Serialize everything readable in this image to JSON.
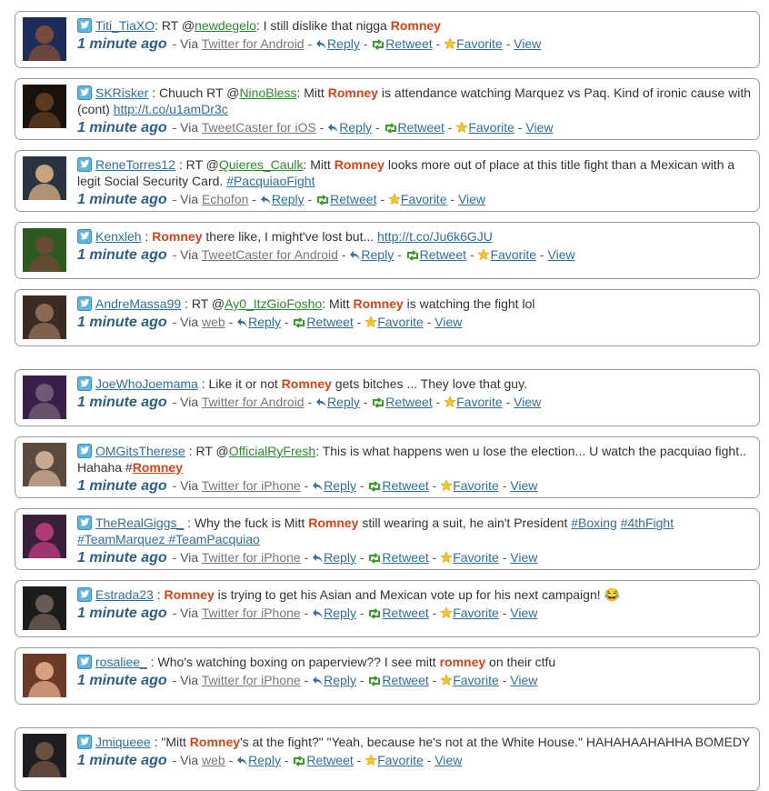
{
  "colors": {
    "highlight": "#d84315",
    "link": "#2f6f9f",
    "mention": "#2b8a2b",
    "time": "#2e5f86"
  },
  "labels": {
    "via": "Via",
    "reply": "Reply",
    "retweet": "Retweet",
    "favorite": "Favorite",
    "view": "View",
    "sep": "-"
  },
  "tweets": [
    {
      "user": "Titi_TiaXO",
      "pre": ": RT @",
      "mention": "newdegelo",
      "mid": ": I still dislike that nigga ",
      "hl": "Romney",
      "post": "",
      "link": "",
      "link2": "",
      "tail": "",
      "time": "1 minute ago",
      "source": "Twitter for Android"
    },
    {
      "user": "SKRisker",
      "pre": " : Chuuch RT @",
      "mention": "NinoBless",
      "mid": ": Mitt ",
      "hl": "Romney",
      "post": " is attendance watching Marquez vs Paq. Kind of ironic cause with (cont) ",
      "link": "http://t.co/u1amDr3c",
      "link2": "",
      "tail": "",
      "time": "1 minute ago",
      "source": "TweetCaster for iOS"
    },
    {
      "user": "ReneTorres12",
      "pre": " : RT @",
      "mention": "Quieres_Caulk",
      "mid": ": Mitt ",
      "hl": "Romney",
      "post": " looks more out of place at this title fight than a Mexican with a legit Social Security Card. ",
      "link": "#PacquiaoFight",
      "link2": "",
      "tail": "",
      "time": "1 minute ago",
      "source": "Echofon"
    },
    {
      "user": "Kenxleh",
      "pre": " : ",
      "mention": "",
      "mid": "",
      "hl": "Romney",
      "post": " there like, I might've lost but... ",
      "link": "http://t.co/Ju6k6GJU",
      "link2": "",
      "tail": "",
      "time": "1 minute ago",
      "source": "TweetCaster for Android"
    },
    {
      "user": "AndreMassa99",
      "pre": " : RT @",
      "mention": "Ay0_ItzGioFosho",
      "mid": ": Mitt ",
      "hl": "Romney",
      "post": " is watching the fight lol",
      "link": "",
      "link2": "",
      "tail": "",
      "time": "1 minute ago",
      "source": "web"
    },
    {
      "user": "JoeWhoJoemama",
      "pre": " : Like it or not ",
      "mention": "",
      "mid": "",
      "hl": "Romney",
      "post": " gets bitches ... They love that guy.",
      "link": "",
      "link2": "",
      "tail": "",
      "time": "1 minute ago",
      "source": "Twitter for Android"
    },
    {
      "user": "OMGitsTherese",
      "pre": " : RT @",
      "mention": "OfficialRyFresh",
      "mid": ": This is what happens wen u lose the election... U watch the pacquiao fight.. Hahaha #",
      "hl": "Romney",
      "post": "",
      "link": "",
      "link2": "",
      "tail": "",
      "time": "1 minute ago",
      "source": "Twitter for iPhone"
    },
    {
      "user": "TheRealGiggs_",
      "pre": " : Why the fuck is Mitt ",
      "mention": "",
      "mid": "",
      "hl": "Romney",
      "post": " still wearing a suit, he ain't President ",
      "link": "#Boxing",
      "link2": "#4thFight",
      "tail": "#TeamMarquez #TeamPacquiao",
      "time": "1 minute ago",
      "source": "Twitter for iPhone"
    },
    {
      "user": "Estrada23",
      "pre": " : ",
      "mention": "",
      "mid": "",
      "hl": "Romney",
      "post": " is trying to get his Asian and Mexican vote up for his next campaign! 😂",
      "link": "",
      "link2": "",
      "tail": "",
      "time": "1 minute ago",
      "source": "Twitter for iPhone"
    },
    {
      "user": "rosaliee_",
      "pre": " : Who's watching boxing on paperview?? I see mitt ",
      "mention": "",
      "mid": "",
      "hl": "romney",
      "post": " on their ctfu",
      "link": "",
      "link2": "",
      "tail": "",
      "time": "1 minute ago",
      "source": "Twitter for iPhone"
    },
    {
      "user": "Jmiqueee",
      "pre": " : \"Mitt ",
      "mention": "",
      "mid": "",
      "hl": "Romney",
      "post": "'s at the fight?\" \"Yeah, because he's not at the White House.\" HAHAHAAHAHHA BOMEDY",
      "link": "",
      "link2": "",
      "tail": "",
      "time": "1 minute ago",
      "source": "web"
    }
  ]
}
